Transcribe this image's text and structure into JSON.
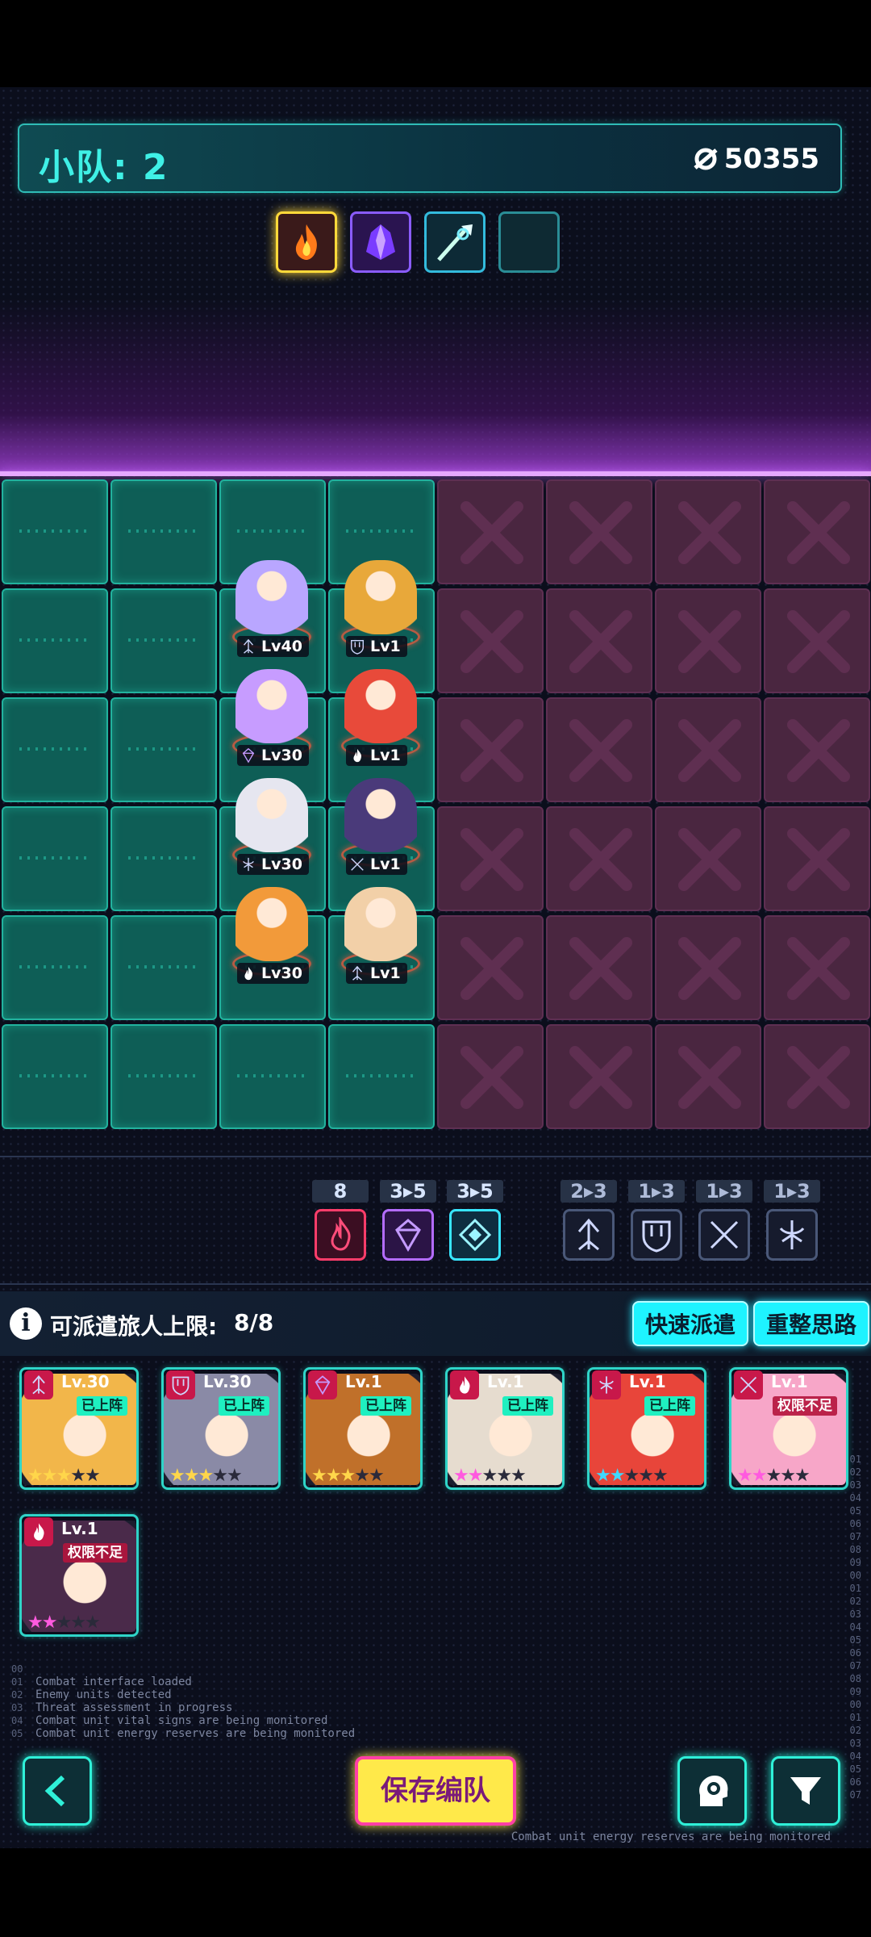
{
  "header": {
    "team_label": "小队: 2",
    "power_value": "50355"
  },
  "factions": [
    {
      "name": "fire-faction-icon",
      "active": true
    },
    {
      "name": "crystal-faction-icon",
      "active": false
    },
    {
      "name": "spear-faction-icon",
      "active": false
    },
    {
      "name": "empty-faction-slot",
      "active": false
    }
  ],
  "units": [
    {
      "level": "Lv40",
      "class_icon": "arrow-class-icon",
      "color": "#b9a6ff"
    },
    {
      "level": "Lv1",
      "class_icon": "shield-class-icon",
      "color": "#e8a83a"
    },
    {
      "level": "Lv30",
      "class_icon": "crystal-class-icon",
      "color": "#c79cff"
    },
    {
      "level": "Lv1",
      "class_icon": "fire-class-icon",
      "color": "#e84a3a"
    },
    {
      "level": "Lv30",
      "class_icon": "bow-class-icon",
      "color": "#e6e6f0"
    },
    {
      "level": "Lv1",
      "class_icon": "blade-class-icon",
      "color": "#4a3a7a"
    },
    {
      "level": "Lv30",
      "class_icon": "fire-class-icon",
      "color": "#f29a3a"
    },
    {
      "level": "Lv1",
      "class_icon": "arrow-class-icon",
      "color": "#f2d0a8"
    }
  ],
  "synergies": [
    {
      "count": "8",
      "style": "red",
      "icon": "flame-synergy-icon"
    },
    {
      "count": "3▸5",
      "style": "purple",
      "icon": "crystal-synergy-icon"
    },
    {
      "count": "3▸5",
      "style": "cyan",
      "icon": "diamond-synergy-icon"
    },
    {
      "count": "2▸3",
      "style": "dim",
      "icon": "arrow-synergy-icon"
    },
    {
      "count": "1▸3",
      "style": "dim",
      "icon": "shield-synergy-icon"
    },
    {
      "count": "1▸3",
      "style": "dim",
      "icon": "crossed-blades-synergy-icon"
    },
    {
      "count": "1▸3",
      "style": "dim",
      "icon": "bow-synergy-icon"
    }
  ],
  "deploy": {
    "label": "可派遣旅人上限:",
    "count": "8/8",
    "quick_button": "快速派遣",
    "reset_button": "重整思路"
  },
  "roster": [
    {
      "level": "Lv.30",
      "status": "已上阵",
      "stars": "★★★★★",
      "lit": 3,
      "star_color": "#ffd64a",
      "bg": "#f2b64a"
    },
    {
      "level": "Lv.30",
      "status": "已上阵",
      "stars": "★★★★★",
      "lit": 3,
      "star_color": "#ffd64a",
      "bg": "#8a8aa6"
    },
    {
      "level": "Lv.1",
      "status": "已上阵",
      "stars": "★★★★★",
      "lit": 3,
      "star_color": "#ffd64a",
      "bg": "#c0702a"
    },
    {
      "level": "Lv.1",
      "status": "已上阵",
      "stars": "★★★★★",
      "lit": 2,
      "star_color": "#ff5adf",
      "bg": "#e6dccf"
    },
    {
      "level": "Lv.1",
      "status": "已上阵",
      "stars": "★★★★★",
      "lit": 2,
      "star_color": "#3fd8ff",
      "bg": "#e8453a"
    },
    {
      "level": "Lv.1",
      "status": "权限不足",
      "stars": "★★★★★",
      "lit": 2,
      "star_color": "#ff5adf",
      "bg": "#f7a6c8"
    },
    {
      "level": "Lv.1",
      "status": "权限不足",
      "stars": "★★★★★",
      "lit": 2,
      "star_color": "#ff5adf",
      "bg": "#4a2a4a"
    }
  ],
  "log": {
    "lines": "Combat interface loaded\nEnemy units detected\nThreat assessment in progress\nCombat unit vital signs are being monitored\nCombat unit energy reserves are being monitored",
    "line_numbers": "00\n01\n02\n03\n04\n05",
    "right_numbers": "01\n02\n03\n04\n05\n06\n07\n08\n09\n00\n01\n02\n03\n04\n05\n06\n07\n08\n09\n00\n01\n02\n03\n04\n05\n06\n07",
    "footer": "Combat unit energy reserves are being monitored"
  },
  "bottom": {
    "save_button": "保存编队"
  }
}
